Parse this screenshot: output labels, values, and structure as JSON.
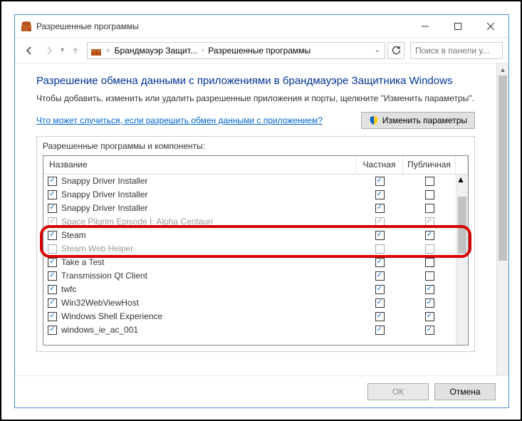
{
  "window": {
    "title": "Разрешенные программы"
  },
  "nav": {
    "crumb1": "Брандмауэр Защит...",
    "crumb2": "Разрешенные программы",
    "search_placeholder": "Поиск в панели у..."
  },
  "page": {
    "heading": "Разрешение обмена данными с приложениями в брандмауэре Защитника Windows",
    "desc": "Чтобы добавить, изменить или удалить разрешенные приложения и порты, щелкните \"Изменить параметры\".",
    "link": "Что может случиться, если разрешить обмен данными с приложением?",
    "change_btn": "Изменить параметры"
  },
  "group": {
    "title": "Разрешенные программы и компоненты:",
    "col_name": "Название",
    "col_private": "Частная",
    "col_public": "Публичная"
  },
  "rows": [
    {
      "enabled": true,
      "name": "Snappy Driver Installer",
      "priv": true,
      "pub": false
    },
    {
      "enabled": true,
      "name": "Snappy Driver Installer",
      "priv": true,
      "pub": false
    },
    {
      "enabled": true,
      "name": "Snappy Driver Installer",
      "priv": true,
      "pub": false
    },
    {
      "enabled": true,
      "name": "Space Pilgrim Episode I: Alpha Centauri",
      "priv": true,
      "pub": true,
      "faded": true
    },
    {
      "enabled": true,
      "name": "Steam",
      "priv": true,
      "pub": true
    },
    {
      "enabled": false,
      "name": "Steam Web Helper",
      "priv": false,
      "pub": false,
      "faded": true
    },
    {
      "enabled": true,
      "name": "Take a Test",
      "priv": true,
      "pub": false
    },
    {
      "enabled": true,
      "name": "Transmission Qt Client",
      "priv": true,
      "pub": false
    },
    {
      "enabled": true,
      "name": "twfc",
      "priv": true,
      "pub": true
    },
    {
      "enabled": true,
      "name": "Win32WebViewHost",
      "priv": true,
      "pub": true
    },
    {
      "enabled": true,
      "name": "Windows Shell Experience",
      "priv": true,
      "pub": true
    },
    {
      "enabled": true,
      "name": "windows_ie_ac_001",
      "priv": true,
      "pub": true
    }
  ],
  "footer": {
    "ok": "ОК",
    "cancel": "Отмена"
  }
}
